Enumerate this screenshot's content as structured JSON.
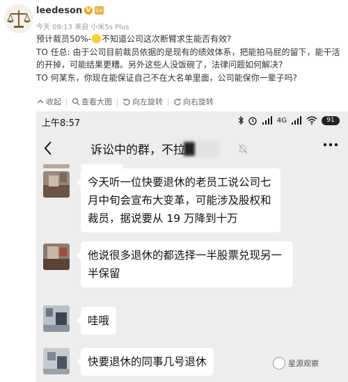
{
  "post": {
    "username": "leedeson",
    "verified_badge": "V",
    "level_badge": "Lv",
    "meta_time": "今天 09:13",
    "meta_source": "来自 小米5s Plus",
    "line1_a": "预计裁员50%-",
    "line1_b": "不知道公司这次断臂求生能否有效?",
    "line2": "TO 任总: 由于公司目前裁员依据的是现有的绩效体系，把能拍马屁的留下，能干活的开掉，可能结果更糟。另外这些人没饭碗了，法律问题如何解决?",
    "line3": "TO 何某东，你现在能保证自己不在大名单里面，公司能保你一辈子吗?"
  },
  "toolbar": {
    "collapse_label": "收起",
    "view_large_label": "查看大图",
    "rotate_left_label": "向左旋转",
    "rotate_right_label": "向右旋转"
  },
  "phone": {
    "status_time": "上午8:57",
    "status_network": "4G",
    "battery": "91",
    "chat_title": "诉讼中的群，不拉",
    "messages": [
      {
        "text": "今天听一位快要退休的老员工说公司七月中旬会宣布大变革，可能涉及股权和裁员，据说要从 19 万降到十万"
      },
      {
        "text": "他说很多退休的都选择一半股票兑现另一半保留"
      },
      {
        "text": "哇哦"
      },
      {
        "text": "快要退休的同事几号退休"
      }
    ]
  },
  "watermark": {
    "text": "星源观察"
  },
  "colors": {
    "chat_background": "#ededed",
    "bubble": "#ffffff",
    "badge_orange": "#f5a623"
  }
}
